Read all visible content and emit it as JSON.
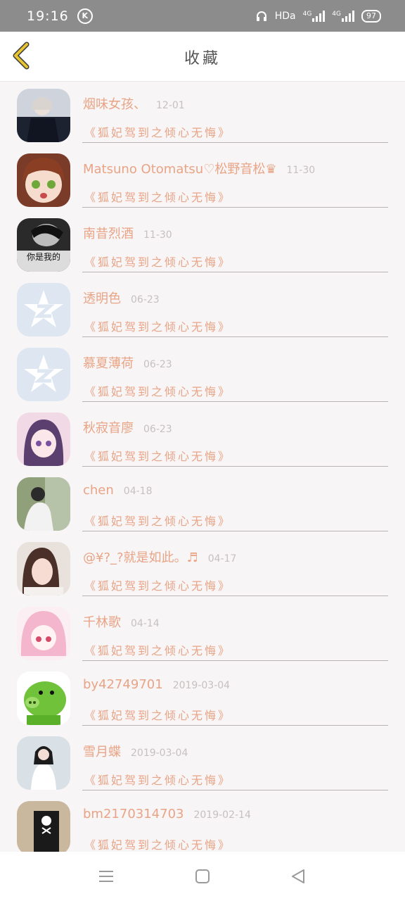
{
  "status": {
    "time": "19:16",
    "k_badge": "K",
    "hd": "HDa",
    "net1": "4G",
    "net2": "4G",
    "battery": "97"
  },
  "header": {
    "title": "收藏"
  },
  "items": [
    {
      "name": "烟味女孩、",
      "date": "12-01",
      "subtitle": "《狐妃驾到之倾心无悔》",
      "avatar": "photo-dark-figure"
    },
    {
      "name": "Matsuno Otomatsu♡松野音松♛",
      "date": "11-30",
      "subtitle": "《狐妃驾到之倾心无悔》",
      "avatar": "anime-girl-brown-hair"
    },
    {
      "name": "南昔烈酒",
      "date": "11-30",
      "subtitle": "《狐妃驾到之倾心无悔》",
      "avatar": "bw-photo-text",
      "avatar_text": "你是我的"
    },
    {
      "name": "透明色",
      "date": "06-23",
      "subtitle": "《狐妃驾到之倾心无悔》",
      "avatar": "qq-default-icon"
    },
    {
      "name": "慕夏薄荷",
      "date": "06-23",
      "subtitle": "《狐妃驾到之倾心无悔》",
      "avatar": "qq-default-icon"
    },
    {
      "name": "秋寂音廖",
      "date": "06-23",
      "subtitle": "《狐妃驾到之倾心无悔》",
      "avatar": "anime-girl-purple-hair"
    },
    {
      "name": "chen",
      "date": "04-18",
      "subtitle": "《狐妃驾到之倾心无悔》",
      "avatar": "photo-green"
    },
    {
      "name": "@¥?_?就是如此。♬",
      "date": "04-17",
      "subtitle": "《狐妃驾到之倾心无悔》",
      "avatar": "photo-girl"
    },
    {
      "name": "千林歌",
      "date": "04-14",
      "subtitle": "《狐妃驾到之倾心无悔》",
      "avatar": "anime-girl-pink-hair"
    },
    {
      "name": "by42749701",
      "date": "2019-03-04",
      "subtitle": "《狐妃驾到之倾心无悔》",
      "avatar": "green-pig"
    },
    {
      "name": "雪月蝶",
      "date": "2019-03-04",
      "subtitle": "《狐妃驾到之倾心无悔》",
      "avatar": "photo-white-dress"
    },
    {
      "name": "bm2170314703",
      "date": "2019-02-14",
      "subtitle": "《狐妃驾到之倾心无悔》",
      "avatar": "photo-skull"
    }
  ],
  "colors": {
    "accent": "#e9a486",
    "back": "#e8c530",
    "date": "#c6c0c0"
  }
}
